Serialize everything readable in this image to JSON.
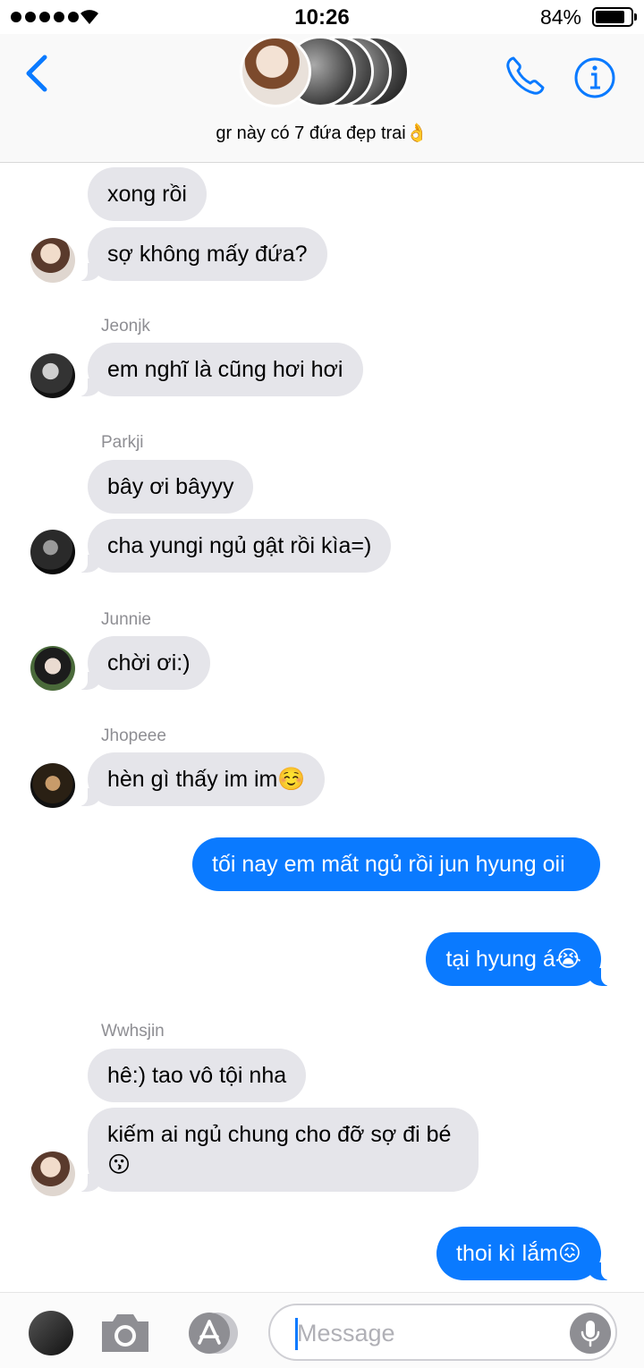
{
  "status_bar": {
    "time": "10:26",
    "battery_percent": "84%",
    "battery_level": 0.84
  },
  "header": {
    "group_title": "gr này có 7 đứa đẹp trai👌",
    "icons": {
      "back": "chevron-left-icon",
      "call": "phone-icon",
      "info": "info-icon"
    },
    "accent_color": "#0a7aff"
  },
  "messages": [
    {
      "type": "incoming",
      "text": "xong rồi"
    },
    {
      "type": "incoming",
      "text": "sợ không mấy đứa?"
    },
    {
      "type": "incoming",
      "sender": "Jeonjk",
      "text": "em nghĩ là cũng hơi hơi"
    },
    {
      "type": "incoming",
      "sender": "Parkji",
      "text": "bây ơi bâyyy"
    },
    {
      "type": "incoming",
      "text": "cha yungi ngủ gật rồi kìa=)"
    },
    {
      "type": "incoming",
      "sender": "Junnie",
      "text": "chời ơi:)"
    },
    {
      "type": "incoming",
      "sender": "Jhopeee",
      "text": "hèn gì thấy im im☺️"
    },
    {
      "type": "outgoing",
      "text": "tối nay em mất ngủ rồi jun hyung oii"
    },
    {
      "type": "outgoing",
      "text": "tại hyung á😭"
    },
    {
      "type": "incoming",
      "sender": "Wwhsjin",
      "text": "hê:) tao vô tội nha"
    },
    {
      "type": "incoming",
      "text": "kiếm ai ngủ chung cho đỡ sợ đi bé😗"
    },
    {
      "type": "outgoing",
      "text": "thoi kì lắm😖"
    }
  ],
  "input_bar": {
    "placeholder": "Message",
    "icons": {
      "camera": "camera-icon",
      "apps": "app-store-icon",
      "mic": "microphone-icon"
    }
  }
}
